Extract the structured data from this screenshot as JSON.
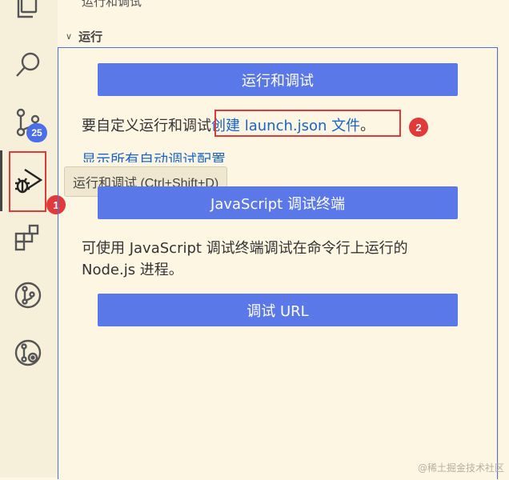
{
  "view": {
    "title": "运行和调试",
    "more": "···"
  },
  "section": {
    "chevron": "∨",
    "title": "运行"
  },
  "activity_bar": {
    "icons": [
      "files-icon",
      "search-icon",
      "source-control-icon",
      "run-and-debug-icon",
      "extensions-icon",
      "git-graph-icon",
      "git-history-icon"
    ],
    "scm_badge": "25"
  },
  "tooltip": {
    "text": "运行和调试 (Ctrl+Shift+D)"
  },
  "annotations": {
    "badge1": "1",
    "badge2": "2",
    "highlight_color": "#e03a3a"
  },
  "main": {
    "run_debug_button": "运行和调试",
    "customize_prefix": "要自定义运行和调试",
    "create_launch_link": "创建 launch.json 文件",
    "customize_suffix": "。",
    "show_all_configs_link": "显示所有自动调试配置",
    "js_terminal_button": "JavaScript 调试终端",
    "js_desc_line1": "可使用 JavaScript 调试终端调试在命令行上运行的",
    "js_desc_line2": "Node.js 进程。",
    "debug_url_button": "调试 URL"
  },
  "colors": {
    "background": "#fdf6e3",
    "button": "#5b78e8",
    "link": "#1a64c9",
    "badge": "#4c6fe7"
  },
  "watermark": "@稀土掘金技术社区"
}
